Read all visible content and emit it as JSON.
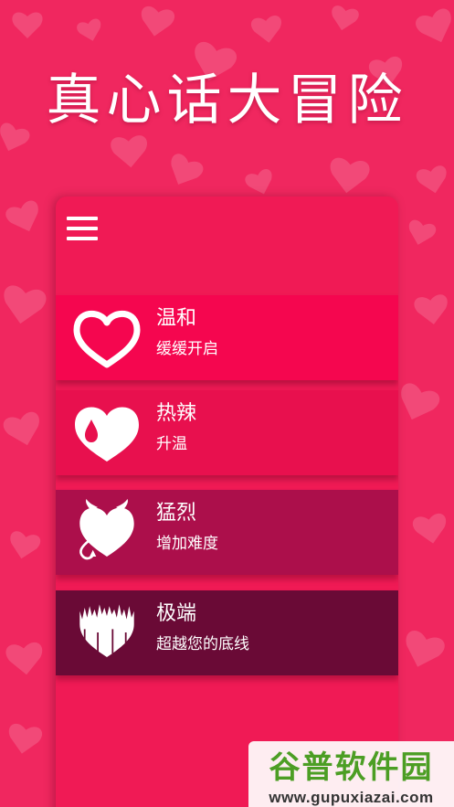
{
  "app": {
    "title": "真心话大冒险"
  },
  "levels": [
    {
      "name": "温和",
      "desc": "缓缓开启",
      "icon": "heart-outline-icon",
      "color": "#f5064f"
    },
    {
      "name": "热辣",
      "desc": "升温",
      "icon": "heart-drop-icon",
      "color": "#e8104e"
    },
    {
      "name": "猛烈",
      "desc": "增加难度",
      "icon": "devil-heart-icon",
      "color": "#ac0f4b"
    },
    {
      "name": "极端",
      "desc": "超越您的底线",
      "icon": "jagged-heart-icon",
      "color": "#6a0a36"
    }
  ],
  "watermark": {
    "name": "谷普软件园",
    "url": "www.gupuxiazai.com"
  },
  "colors": {
    "background": "#f0275f",
    "panel": "#f01a55",
    "text": "#ffffff"
  }
}
